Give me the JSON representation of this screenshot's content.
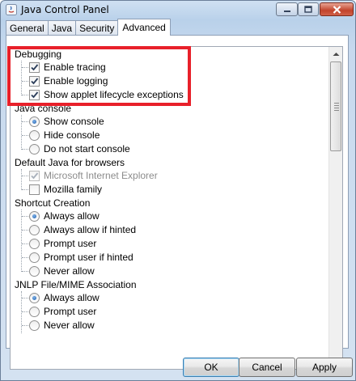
{
  "window": {
    "title": "Java Control Panel"
  },
  "tabs": [
    {
      "label": "General"
    },
    {
      "label": "Java"
    },
    {
      "label": "Security"
    },
    {
      "label": "Advanced"
    }
  ],
  "settings": {
    "debugging": {
      "heading": "Debugging",
      "items": [
        {
          "label": "Enable tracing",
          "checked": true
        },
        {
          "label": "Enable logging",
          "checked": true
        },
        {
          "label": "Show applet lifecycle exceptions",
          "checked": true
        }
      ]
    },
    "java_console": {
      "heading": "Java console",
      "options": [
        {
          "label": "Show console",
          "selected": true
        },
        {
          "label": "Hide console",
          "selected": false
        },
        {
          "label": "Do not start console",
          "selected": false
        }
      ]
    },
    "default_java": {
      "heading": "Default Java for browsers",
      "items": [
        {
          "label": "Microsoft Internet Explorer",
          "checked": true,
          "disabled": true
        },
        {
          "label": "Mozilla family",
          "checked": false,
          "disabled": false
        }
      ]
    },
    "shortcut_creation": {
      "heading": "Shortcut Creation",
      "options": [
        {
          "label": "Always allow",
          "selected": true
        },
        {
          "label": "Always allow if hinted",
          "selected": false
        },
        {
          "label": "Prompt user",
          "selected": false
        },
        {
          "label": "Prompt user if hinted",
          "selected": false
        },
        {
          "label": "Never allow",
          "selected": false
        }
      ]
    },
    "jnlp": {
      "heading": "JNLP File/MIME Association",
      "options": [
        {
          "label": "Always allow",
          "selected": true
        },
        {
          "label": "Prompt user",
          "selected": false
        },
        {
          "label": "Never allow",
          "selected": false
        }
      ]
    }
  },
  "buttons": {
    "ok": "OK",
    "cancel": "Cancel",
    "apply": "Apply"
  },
  "colors": {
    "highlight": "#e8202a",
    "radio_selected": "#1d5fae"
  }
}
